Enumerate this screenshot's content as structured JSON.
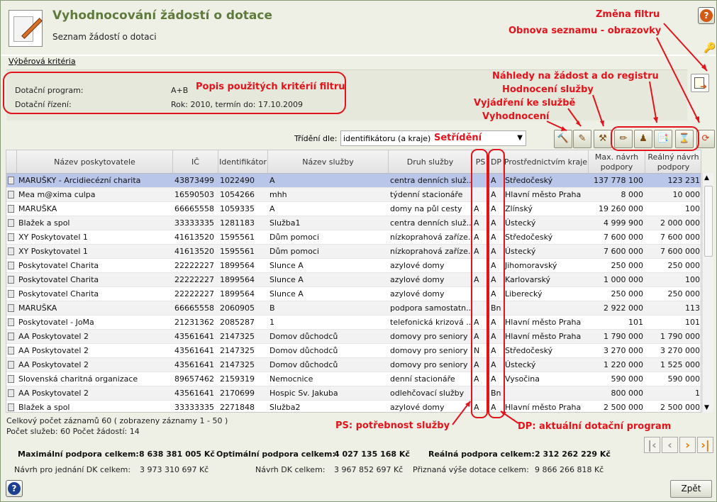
{
  "header": {
    "title": "Vyhodnocování žádostí o dotace",
    "subtitle": "Seznam žádostí o dotaci"
  },
  "criteria": {
    "label": "Výběrová kritéria",
    "rows": [
      {
        "key": "Dotační program:",
        "value": "A+B"
      },
      {
        "key": "Dotační řízení:",
        "value": "Rok: 2010, termín do: 17.10.2009"
      }
    ]
  },
  "sort": {
    "label": "Třídění dle:",
    "selected": "identifikátoru (a kraje)"
  },
  "toolbar_icons": [
    "evaluation-icon",
    "statement-icon",
    "service-rating-icon",
    "preview-edit-icon",
    "preview-person-icon",
    "preview-documents-icon",
    "registry-icon",
    "refresh-icon"
  ],
  "table": {
    "headers": [
      "Název poskytovatele",
      "IČ",
      "Identifikátor",
      "Název služby",
      "Druh služby",
      "PS",
      "DP",
      "Prostřednictvím kraje",
      "Max. návrh podpory",
      "Reálný návrh podpory"
    ],
    "rows": [
      [
        "MARUŠKY - Arcidiecézní charita",
        "43873499",
        "1022490",
        "A",
        "centra denních služ...",
        "",
        "A",
        "Středočeský",
        "137 778 100",
        "123 231"
      ],
      [
        "Mea m@xima culpa",
        "16590503",
        "1054266",
        "mhh",
        "týdenní stacionáře",
        "",
        "A",
        "Hlavní město Praha",
        "8 000",
        "10 000"
      ],
      [
        "MARUŠKA",
        "66665558",
        "1059335",
        "A",
        "domy na půl cesty",
        "A",
        "A",
        "Zlínský",
        "19 260 000",
        "100"
      ],
      [
        "Blažek a spol",
        "33333335",
        "1281183",
        "Služba1",
        "centra denních služ...",
        "A",
        "A",
        "Ústecký",
        "4 999 900",
        "2 000 000"
      ],
      [
        "XY Poskytovatel 1",
        "41613520",
        "1595561",
        "Dům pomoci",
        "nízkoprahová zaříze...",
        "A",
        "A",
        "Středočeský",
        "7 600 000",
        "7 600 000"
      ],
      [
        "XY Poskytovatel 1",
        "41613520",
        "1595561",
        "Dům pomoci",
        "nízkoprahová zaříze...",
        "A",
        "A",
        "Ústecký",
        "7 600 000",
        "7 600 000"
      ],
      [
        "Poskytovatel Charita",
        "22222227",
        "1899564",
        "Slunce A",
        "azylové domy",
        "",
        "A",
        "Jihomoravský",
        "250 000",
        "250 000"
      ],
      [
        "Poskytovatel Charita",
        "22222227",
        "1899564",
        "Slunce A",
        "azylové domy",
        "A",
        "A",
        "Karlovarský",
        "1 000 000",
        "100"
      ],
      [
        "Poskytovatel Charita",
        "22222227",
        "1899564",
        "Slunce A",
        "azylové domy",
        "",
        "A",
        "Liberecký",
        "250 000",
        "250 000"
      ],
      [
        "MARUŠKA",
        "66665558",
        "2060905",
        "B",
        "podpora samostatn...",
        "",
        "Bn",
        "",
        "2 922 000",
        "113"
      ],
      [
        "Poskytovatel - JoMa",
        "21231362",
        "2085287",
        "1",
        "telefonická krizová ...",
        "A",
        "A",
        "Hlavní město Praha",
        "101",
        "101"
      ],
      [
        "AA Poskytovatel 2",
        "43561641",
        "2147325",
        "Domov důchodců",
        "domovy pro seniory",
        "A",
        "A",
        "Hlavní město Praha",
        "1 790 000",
        "1 790 000"
      ],
      [
        "AA Poskytovatel 2",
        "43561641",
        "2147325",
        "Domov důchodců",
        "domovy pro seniory",
        "N",
        "A",
        "Středočeský",
        "3 270 000",
        "3 270 000"
      ],
      [
        "AA Poskytovatel 2",
        "43561641",
        "2147325",
        "Domov důchodců",
        "domovy pro seniory",
        "A",
        "A",
        "Ústecký",
        "1 220 000",
        "1 525 000"
      ],
      [
        "Slovenská charitná organizace",
        "89657462",
        "2159319",
        "Nemocnice",
        "denní stacionáře",
        "A",
        "A",
        "Vysočina",
        "590 000",
        "590 000"
      ],
      [
        "AA Poskytovatel 2",
        "43561641",
        "2170699",
        "Hospic Sv. Jakuba",
        "odlehčovací služby",
        "",
        "Bn",
        "",
        "800 000",
        "1"
      ],
      [
        "Blažek a spol",
        "33333335",
        "2271848",
        "Služba2",
        "azylové domy",
        "A",
        "A",
        "Hlavní město Praha",
        "2 500 000",
        "2 500 000"
      ]
    ]
  },
  "footer": {
    "records": "Celkový počet záznamů 60 ( zobrazeny záznamy 1 - 50 )",
    "counts": "Počet služeb: 60 Počet žádostí: 14",
    "totals": [
      {
        "label": "Maximální podpora celkem:",
        "value": "8 638 381 005 Kč"
      },
      {
        "label": "Optimální podpora celkem:",
        "value": "4 027 135 168 Kč"
      },
      {
        "label": "Reálná podpora celkem:",
        "value": "2 312 262 229 Kč"
      }
    ],
    "totals2": [
      {
        "label": "Návrh pro jednání DK celkem:",
        "value": "3 973 310 697 Kč"
      },
      {
        "label": "Návrh DK celkem:",
        "value": "3 967 852 697 Kč"
      },
      {
        "label": "Přiznaná výše dotace celkem:",
        "value": "9 866 266 818 Kč"
      }
    ],
    "back_button": "Zpět"
  },
  "annotations": {
    "zmena_filtru": "Změna filtru",
    "obnova": "Obnova seznamu - obrazovky",
    "popis": "Popis použitých kritérií filtru",
    "nahledy": "Náhledy na žádost a do registru",
    "hodnoceni": "Hodnocení služby",
    "vyjadreni": "Vyjádření ke službě",
    "vyhodnoceni": "Vyhodnocení",
    "setrideni": "Setřídění",
    "ps": "PS: potřebnost služby",
    "dp": "DP: aktuální dotační program"
  },
  "colors": {
    "title": "#5f7a3d",
    "annotation": "#e3131b",
    "selected_row": "#b9c5e9"
  }
}
